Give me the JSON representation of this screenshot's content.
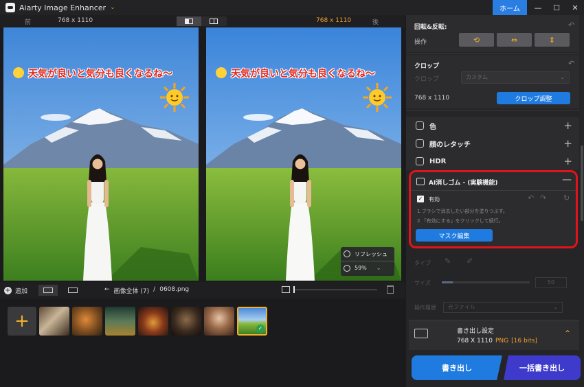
{
  "titlebar": {
    "app_name": "Aiarty Image Enhancer",
    "chevron": "⌄",
    "home_label": "ホーム",
    "minimize": "—",
    "maximize": "☐",
    "close": "✕"
  },
  "compare": {
    "before_label": "前",
    "after_label": "後",
    "left_resolution": "768 x 1110",
    "right_resolution": "768 x 1110"
  },
  "image": {
    "caption": "天気が良いと気分も良くなるね～"
  },
  "preview_overlay": {
    "refresh_label": "リフレッシュ",
    "zoom_value": "59%",
    "zoom_chevron": "⌄"
  },
  "bottombar": {
    "add_label": "追加",
    "breadcrumb_root": "画像全体 (7)",
    "breadcrumb_sep": "/",
    "file_name": "0608.png"
  },
  "thumbnails": {
    "add_symbol": "+",
    "selected_check": "✓"
  },
  "panel": {
    "rotate": {
      "title": "回転&反転:",
      "op_label": "操作",
      "buttons": [
        "⟲",
        "⇔",
        "⇕"
      ]
    },
    "crop": {
      "title": "クロップ",
      "crop_label": "クロップ",
      "select_value": "カスタム",
      "size_text": "768 x 1110",
      "adjust_button": "クロップ調整"
    },
    "items": [
      {
        "label": "色",
        "plus": "+"
      },
      {
        "label": "顔のレタッチ",
        "plus": "+"
      },
      {
        "label": "HDR",
        "plus": "+"
      }
    ],
    "ai_eraser": {
      "title": "AI消しゴム - (実験機能)",
      "collapse": "—",
      "enabled_label": "有効",
      "step1": "1.ブラシで消去したい部分を塗りつぶす。",
      "step2": "2.「有効にする」をクリックして続行。",
      "mask_button": "マスク編集"
    },
    "dimmed": {
      "type_label": "タイプ",
      "size_label": "サイズ",
      "size_value": "50",
      "history_label": "操作履歴",
      "history_value": "元ファイル"
    },
    "export": {
      "title": "書き出し設定",
      "size": "768 X 1110",
      "format": "PNG",
      "bits": "[16 bits]",
      "expand": "⌃"
    },
    "export_button": "書き出し",
    "batch_button": "一括書き出し"
  }
}
